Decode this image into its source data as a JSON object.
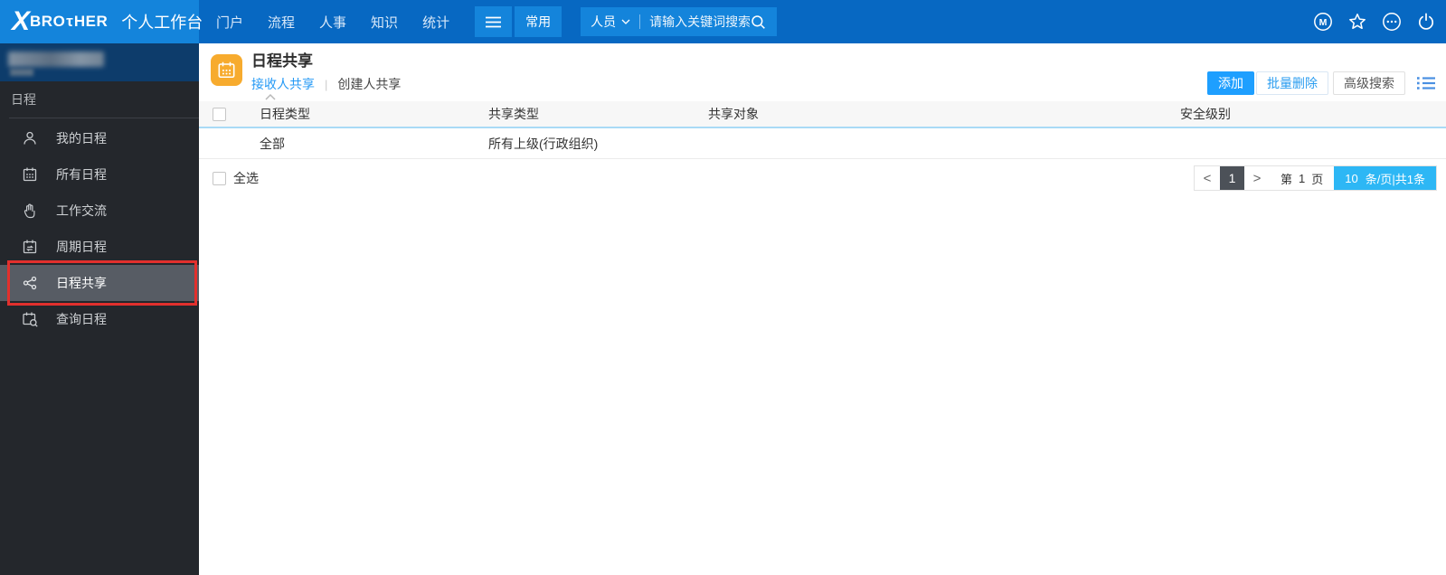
{
  "topbar": {
    "brand": {
      "x": "X",
      "bro": "BRO",
      "t": "τ",
      "her": "HER",
      "divider": "|",
      "workspace": "个人工作台"
    },
    "nav": [
      "门户",
      "流程",
      "人事",
      "知识",
      "统计"
    ],
    "quick_button": "常用",
    "search": {
      "category": "人员",
      "placeholder": "请输入关键词搜索"
    },
    "icons": [
      "m-badge-icon",
      "favorite-star-icon",
      "more-circle-icon",
      "power-icon"
    ]
  },
  "sidebar": {
    "section": "日程",
    "items": [
      {
        "label": "我的日程",
        "icon": "user-icon",
        "selected": false
      },
      {
        "label": "所有日程",
        "icon": "calendar-icon",
        "selected": false
      },
      {
        "label": "工作交流",
        "icon": "hand-icon",
        "selected": false
      },
      {
        "label": "周期日程",
        "icon": "calendar-repeat-icon",
        "selected": false
      },
      {
        "label": "日程共享",
        "icon": "share-icon",
        "selected": true
      },
      {
        "label": "查询日程",
        "icon": "calendar-search-icon",
        "selected": false
      }
    ]
  },
  "page": {
    "title": "日程共享",
    "title_icon": "calendar-icon",
    "tabs": [
      {
        "label": "接收人共享",
        "active": true
      },
      {
        "label": "创建人共享",
        "active": false
      }
    ],
    "tab_divider": "|",
    "actions": {
      "add": "添加",
      "batch_delete": "批量删除",
      "advanced_search": "高级搜索"
    }
  },
  "table": {
    "columns": [
      "日程类型",
      "共享类型",
      "共享对象",
      "安全级别"
    ],
    "rows": [
      {
        "schedule_type": "全部",
        "share_type": "所有上级(行政组织)",
        "share_target": "",
        "security_level": ""
      }
    ]
  },
  "footer": {
    "select_all": "全选",
    "pagination": {
      "prev": "<",
      "current": "1",
      "next": ">",
      "page_label_prefix": "第",
      "page_number": "1",
      "page_label_suffix": "页",
      "page_size": "10",
      "count_label": "条/页|共1条"
    }
  },
  "colors": {
    "topbar": "#0768c2",
    "topbar_light": "#1484db",
    "accent": "#1e9fff",
    "pagination_blue": "#2db7f5",
    "selected_red": "#e2302d",
    "title_icon_amber": "#f7ab2e",
    "sidebar_bg": "#24272c",
    "sidebar_selected": "#575c64"
  }
}
